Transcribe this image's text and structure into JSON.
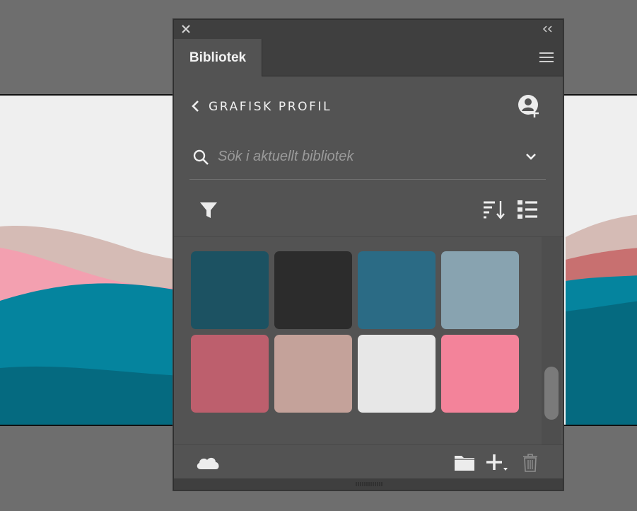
{
  "panel": {
    "tab_label": "Bibliotek",
    "library_title": "GRAFISK PROFIL",
    "search_placeholder": "Sök i aktuellt bibliotek"
  },
  "icons": [
    "close-icon",
    "collapse-icon",
    "menu-icon",
    "back-icon",
    "add-user-icon",
    "search-icon",
    "chevron-down-icon",
    "filter-icon",
    "sort-icon",
    "list-view-icon",
    "cloud-icon",
    "folder-icon",
    "add-icon",
    "trash-icon"
  ],
  "swatches": [
    {
      "color": "#1c5262"
    },
    {
      "color": "#2c2c2c"
    },
    {
      "color": "#2b6b85"
    },
    {
      "color": "#88a3b0"
    },
    {
      "color": "#bd5f6d"
    },
    {
      "color": "#c4a29a"
    },
    {
      "color": "#e7e7e7"
    },
    {
      "color": "#f3839a"
    }
  ],
  "colors": {
    "panel_bg": "#535353",
    "titlebar_bg": "#3f3f3f",
    "workspace_bg": "#6e6e6e"
  }
}
